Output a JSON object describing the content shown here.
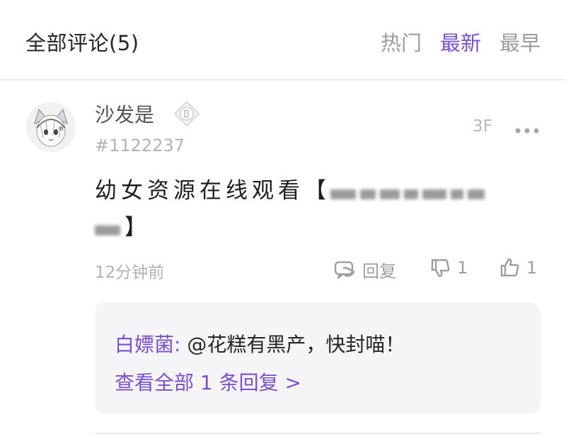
{
  "header": {
    "title": "全部评论(5)",
    "tabs": [
      {
        "label": "热门",
        "active": false
      },
      {
        "label": "最新",
        "active": true
      },
      {
        "label": "最早",
        "active": false
      }
    ]
  },
  "comment": {
    "username": "沙发是",
    "user_id": "#1122237",
    "floor": "3F",
    "text_prefix": "幼女资源在线观看【",
    "text_suffix": "】",
    "time": "12分钟前",
    "reply_label": "回复",
    "dislike_count": "1",
    "like_count": "1"
  },
  "reply": {
    "author": "白嫖菌:",
    "text": " @花糕有黑产，快封喵！",
    "view_all": "查看全部 1 条回复 >"
  },
  "colors": {
    "accent": "#7a4fd0",
    "muted": "#9e9e9e",
    "reply_bg": "#f5f5f7"
  },
  "icons": [
    "avatar",
    "badge-icon",
    "more-icon",
    "reply-icon",
    "dislike-icon",
    "like-icon"
  ]
}
